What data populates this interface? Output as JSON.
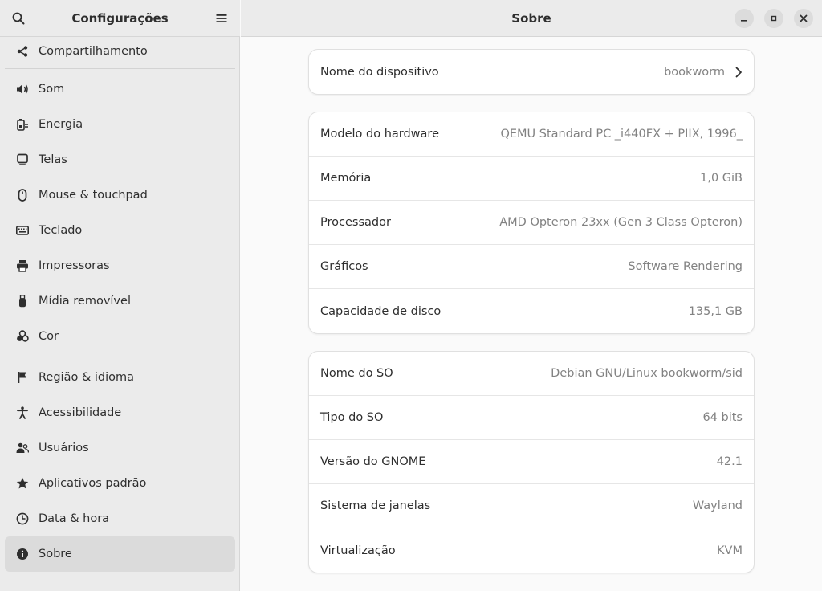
{
  "sidebar": {
    "title": "Configurações",
    "items": [
      {
        "label": "Compartilhamento",
        "icon": "share-icon"
      },
      {
        "label": "Som",
        "icon": "speaker-icon"
      },
      {
        "label": "Energia",
        "icon": "power-icon"
      },
      {
        "label": "Telas",
        "icon": "display-icon"
      },
      {
        "label": "Mouse & touchpad",
        "icon": "mouse-icon"
      },
      {
        "label": "Teclado",
        "icon": "keyboard-icon"
      },
      {
        "label": "Impressoras",
        "icon": "printer-icon"
      },
      {
        "label": "Mídia removível",
        "icon": "usb-icon"
      },
      {
        "label": "Cor",
        "icon": "color-icon"
      },
      {
        "label": "Região & idioma",
        "icon": "flag-icon"
      },
      {
        "label": "Acessibilidade",
        "icon": "accessibility-icon"
      },
      {
        "label": "Usuários",
        "icon": "users-icon"
      },
      {
        "label": "Aplicativos padrão",
        "icon": "star-icon"
      },
      {
        "label": "Data & hora",
        "icon": "clock-icon"
      },
      {
        "label": "Sobre",
        "icon": "info-icon",
        "selected": true
      }
    ]
  },
  "main": {
    "title": "Sobre",
    "device": {
      "label": "Nome do dispositivo",
      "value": "bookworm"
    },
    "hardware": [
      {
        "label": "Modelo do hardware",
        "value": "QEMU Standard PC _i440FX + PIIX, 1996_"
      },
      {
        "label": "Memória",
        "value": "1,0 GiB"
      },
      {
        "label": "Processador",
        "value": "AMD Opteron 23xx (Gen 3 Class Opteron)"
      },
      {
        "label": "Gráficos",
        "value": "Software Rendering"
      },
      {
        "label": "Capacidade de disco",
        "value": "135,1 GB"
      }
    ],
    "os": [
      {
        "label": "Nome do SO",
        "value": "Debian GNU/Linux bookworm/sid"
      },
      {
        "label": "Tipo do SO",
        "value": "64 bits"
      },
      {
        "label": "Versão do GNOME",
        "value": "42.1"
      },
      {
        "label": "Sistema de janelas",
        "value": "Wayland"
      },
      {
        "label": "Virtualização",
        "value": "KVM"
      }
    ]
  },
  "colors": {
    "sidebar_bg": "#ebebeb",
    "selected_bg": "#dbdbdb",
    "value_text": "#828282"
  }
}
